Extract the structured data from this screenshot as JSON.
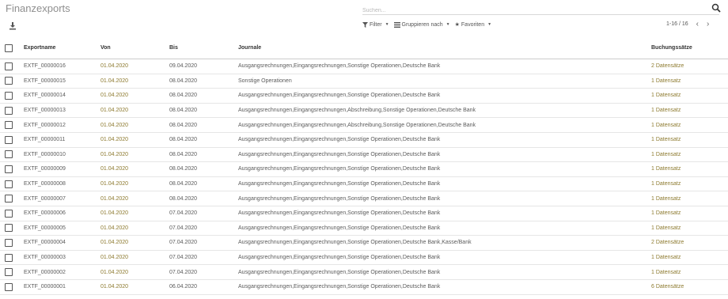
{
  "header": {
    "title": "Finanzexports",
    "search_placeholder": "Suchen...",
    "filter_label": "Filter",
    "group_label": "Gruppieren nach",
    "favorites_label": "Favoriten",
    "pager": "1-16 / 16"
  },
  "table": {
    "columns": [
      "Exportname",
      "Von",
      "Bis",
      "Journale",
      "Buchungssätze"
    ],
    "rows": [
      {
        "name": "EXTF_00000016",
        "von": "01.04.2020",
        "bis": "09.04.2020",
        "journale": "Ausgangsrechnungen,Eingangsrechnungen,Sonstige Operationen,Deutsche Bank",
        "buch": "2 Datensätze"
      },
      {
        "name": "EXTF_00000015",
        "von": "01.04.2020",
        "bis": "08.04.2020",
        "journale": "Sonstige Operationen",
        "buch": "1 Datensatz"
      },
      {
        "name": "EXTF_00000014",
        "von": "01.04.2020",
        "bis": "08.04.2020",
        "journale": "Ausgangsrechnungen,Eingangsrechnungen,Sonstige Operationen,Deutsche Bank",
        "buch": "1 Datensatz"
      },
      {
        "name": "EXTF_00000013",
        "von": "01.04.2020",
        "bis": "08.04.2020",
        "journale": "Ausgangsrechnungen,Eingangsrechnungen,Abschreibung,Sonstige Operationen,Deutsche Bank",
        "buch": "1 Datensatz"
      },
      {
        "name": "EXTF_00000012",
        "von": "01.04.2020",
        "bis": "08.04.2020",
        "journale": "Ausgangsrechnungen,Eingangsrechnungen,Abschreibung,Sonstige Operationen,Deutsche Bank",
        "buch": "1 Datensatz"
      },
      {
        "name": "EXTF_00000011",
        "von": "01.04.2020",
        "bis": "08.04.2020",
        "journale": "Ausgangsrechnungen,Eingangsrechnungen,Sonstige Operationen,Deutsche Bank",
        "buch": "1 Datensatz"
      },
      {
        "name": "EXTF_00000010",
        "von": "01.04.2020",
        "bis": "08.04.2020",
        "journale": "Ausgangsrechnungen,Eingangsrechnungen,Sonstige Operationen,Deutsche Bank",
        "buch": "1 Datensatz"
      },
      {
        "name": "EXTF_00000009",
        "von": "01.04.2020",
        "bis": "08.04.2020",
        "journale": "Ausgangsrechnungen,Eingangsrechnungen,Sonstige Operationen,Deutsche Bank",
        "buch": "1 Datensatz"
      },
      {
        "name": "EXTF_00000008",
        "von": "01.04.2020",
        "bis": "08.04.2020",
        "journale": "Ausgangsrechnungen,Eingangsrechnungen,Sonstige Operationen,Deutsche Bank",
        "buch": "1 Datensatz"
      },
      {
        "name": "EXTF_00000007",
        "von": "01.04.2020",
        "bis": "08.04.2020",
        "journale": "Ausgangsrechnungen,Eingangsrechnungen,Sonstige Operationen,Deutsche Bank",
        "buch": "1 Datensatz"
      },
      {
        "name": "EXTF_00000006",
        "von": "01.04.2020",
        "bis": "07.04.2020",
        "journale": "Ausgangsrechnungen,Eingangsrechnungen,Sonstige Operationen,Deutsche Bank",
        "buch": "1 Datensatz"
      },
      {
        "name": "EXTF_00000005",
        "von": "01.04.2020",
        "bis": "07.04.2020",
        "journale": "Ausgangsrechnungen,Eingangsrechnungen,Sonstige Operationen,Deutsche Bank",
        "buch": "1 Datensatz"
      },
      {
        "name": "EXTF_00000004",
        "von": "01.04.2020",
        "bis": "07.04.2020",
        "journale": "Ausgangsrechnungen,Eingangsrechnungen,Sonstige Operationen,Deutsche Bank,Kasse/Bank",
        "buch": "2 Datensätze"
      },
      {
        "name": "EXTF_00000003",
        "von": "01.04.2020",
        "bis": "07.04.2020",
        "journale": "Ausgangsrechnungen,Eingangsrechnungen,Sonstige Operationen,Deutsche Bank",
        "buch": "1 Datensatz"
      },
      {
        "name": "EXTF_00000002",
        "von": "01.04.2020",
        "bis": "07.04.2020",
        "journale": "Ausgangsrechnungen,Eingangsrechnungen,Sonstige Operationen,Deutsche Bank",
        "buch": "1 Datensatz"
      },
      {
        "name": "EXTF_00000001",
        "von": "01.04.2020",
        "bis": "06.04.2020",
        "journale": "Ausgangsrechnungen,Eingangsrechnungen,Sonstige Operationen,Deutsche Bank",
        "buch": "6 Datensätze"
      }
    ]
  }
}
